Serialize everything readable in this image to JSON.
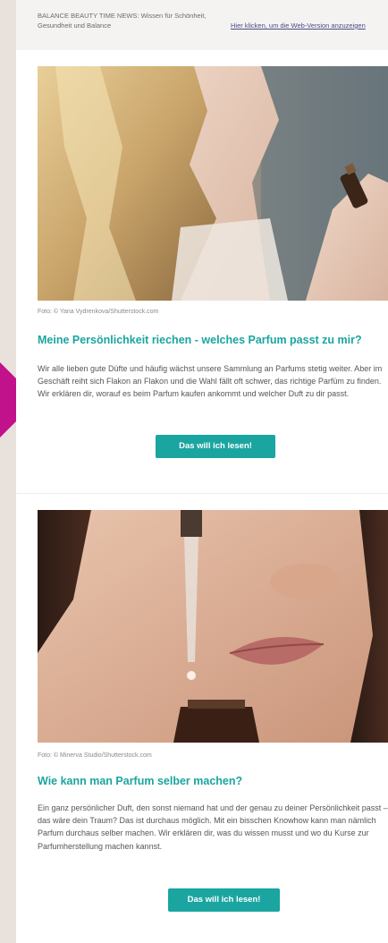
{
  "preheader": {
    "text": "BALANCE BEAUTY TIME NEWS: Wissen für Schönheit, Gesundheit und Balance",
    "web_link": "Hier klicken, um die Web-Version anzuzeigen"
  },
  "articles": [
    {
      "caption": "Foto: © Yana Vydrenkova/Shutterstock.com",
      "headline": "Meine Persönlichkeit riechen - welches Parfum passt zu mir?",
      "body": "Wir alle lieben gute Düfte und häufig wächst unsere Sammlung an Parfums stetig weiter. Aber im Geschäft reiht sich Flakon an Flakon und die Wahl fällt oft schwer, das richtige Parfüm zu finden. Wir erklären dir, worauf es beim Parfum kaufen ankommt und welcher Duft zu dir passt.",
      "cta": "Das will ich lesen!"
    },
    {
      "caption": "Foto: © Minerva Studio/Shutterstock.com",
      "headline": "Wie kann man Parfum selber machen?",
      "body": "Ein ganz persönlicher Duft, den sonst niemand hat und der genau zu deiner Persönlichkeit passt – das wäre dein Traum? Das ist durchaus möglich. Mit ein bisschen Knowhow kann man nämlich Parfum durchaus selber machen. Wir erklären dir, was du wissen musst und wo du Kurse zur Parfumherstellung machen kannst.",
      "cta": "Das will ich lesen!"
    }
  ],
  "colors": {
    "accent": "#1aa5a0",
    "arrow": "#c2128b",
    "background": "#e8e1dc"
  }
}
